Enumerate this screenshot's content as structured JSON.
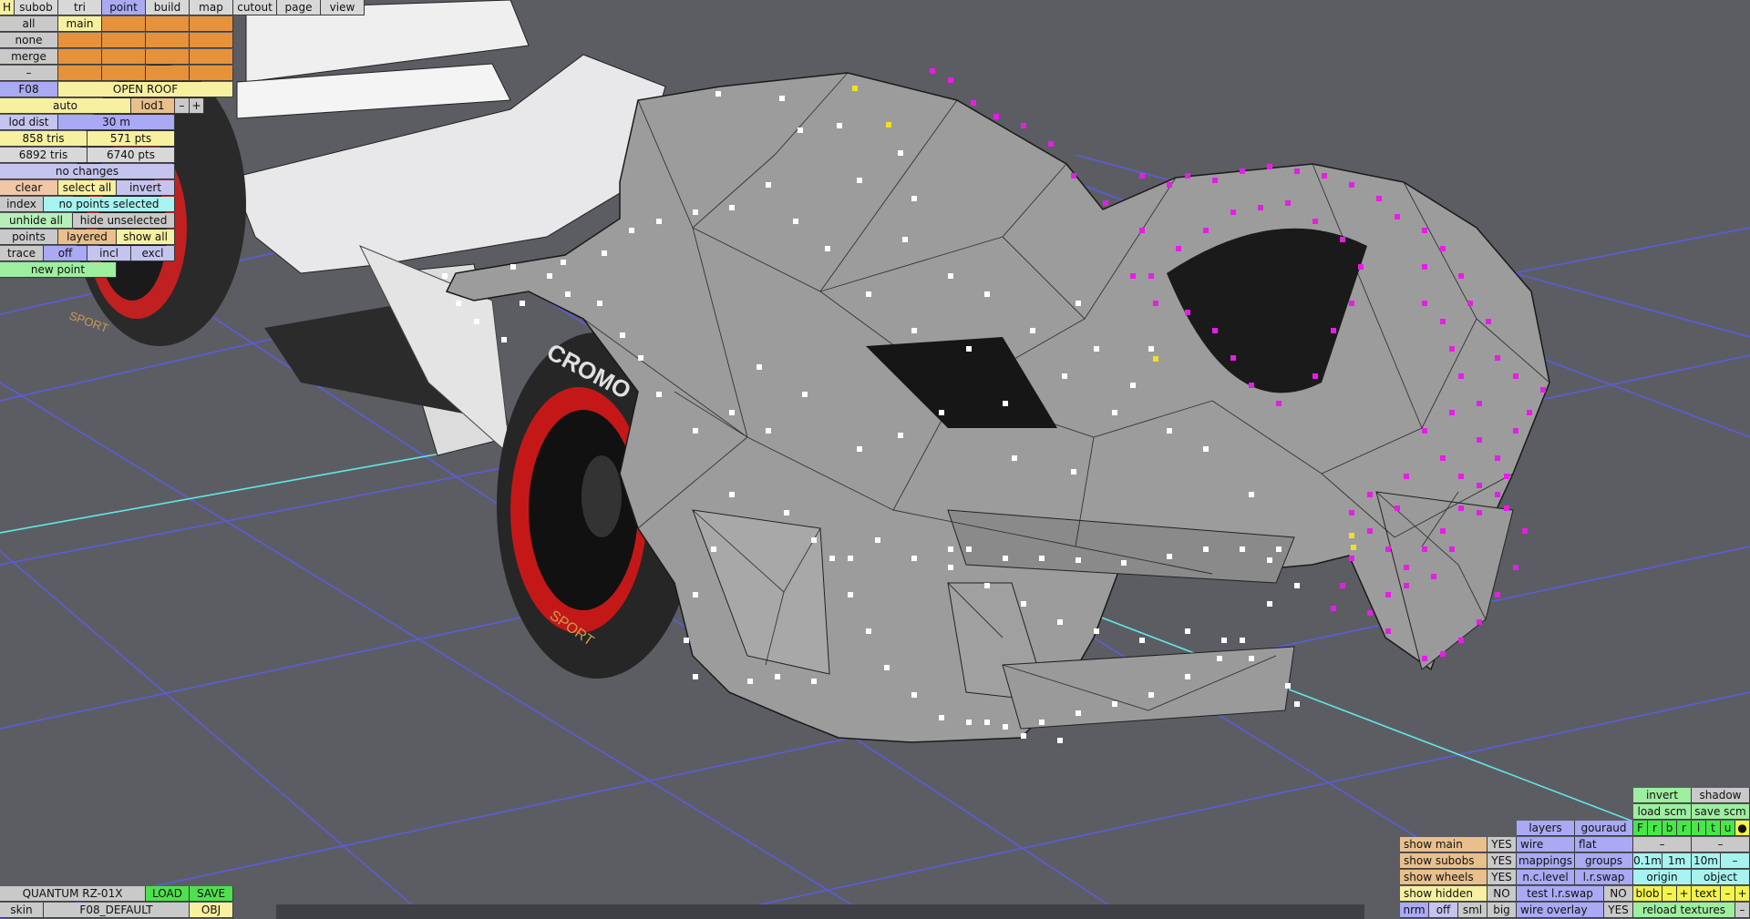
{
  "menu": {
    "h": "H",
    "tabs": [
      "subob",
      "tri",
      "point",
      "build",
      "map",
      "cutout",
      "page",
      "view"
    ],
    "active": "point"
  },
  "subob": {
    "row1": [
      "all",
      "main"
    ],
    "row2": "none",
    "row3": "merge",
    "row4": "–",
    "row5": [
      "F08",
      "OPEN ROOF"
    ]
  },
  "lod": {
    "auto": "auto",
    "lod1": "lod1",
    "minus": "–",
    "plus": "+",
    "dist_label": "lod dist",
    "dist_value": "30 m"
  },
  "stats": {
    "tris1": "858 tris",
    "pts1": "571 pts",
    "tris2": "6892 tris",
    "pts2": "6740 pts",
    "changes": "no changes"
  },
  "selection": {
    "clear": "clear",
    "select_all": "select all",
    "invert": "invert",
    "index": "index",
    "no_points": "no points selected",
    "unhide_all": "unhide all",
    "hide_unselected": "hide unselected",
    "points": "points",
    "layered": "layered",
    "show_all": "show all",
    "trace": "trace",
    "off": "off",
    "incl": "incl",
    "excl": "excl",
    "new_point": "new point"
  },
  "bottom_left": {
    "name": "QUANTUM RZ-01X",
    "load": "LOAD",
    "save": "SAVE",
    "skin": "skin",
    "skin_value": "F08_DEFAULT",
    "obj": "OBJ"
  },
  "bottom_right": {
    "invert": "invert",
    "shadow": "shadow",
    "load_scm": "load scm",
    "save_scm": "save scm",
    "layer_letters": [
      "F",
      "r",
      "b",
      "r",
      "l",
      "t",
      "u"
    ],
    "dot": "●",
    "layers": "layers",
    "gouraud": "gouraud",
    "show_main": "show main",
    "show_subobs": "show subobs",
    "show_wheels": "show wheels",
    "show_hidden": "show hidden",
    "yes": "YES",
    "no": "NO",
    "wire": "wire",
    "flat": "flat",
    "mappings": "mappings",
    "groups": "groups",
    "nclevel": "n.c.level",
    "lrswap": "l.r.swap",
    "test_lrswap": "test l.r.swap",
    "wire_overlay": "wire overlay",
    "dash": "–",
    "g01": "0.1m",
    "g1": "1m",
    "g10": "10m",
    "origin": "origin",
    "object": "object",
    "blob": "blob",
    "text": "text",
    "plus": "+",
    "reload_textures": "reload textures",
    "nrm": "nrm",
    "off": "off",
    "sml": "sml",
    "big": "big"
  },
  "viewport": {
    "tire_front": "CROMO",
    "tire_sidewall": "SPORT",
    "tire_left": "SPORT"
  },
  "colors": {
    "grid": "#5a5cf0",
    "axis": "#60e8e8",
    "selected_pts": "#e81ce8",
    "pts": "#ffffff",
    "marker": "#f0e020"
  }
}
